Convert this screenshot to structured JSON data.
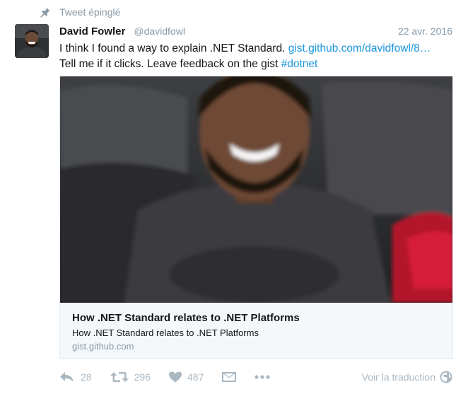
{
  "pinned_label": "Tweet épinglé",
  "tweet": {
    "author_name": "David Fowler",
    "author_handle": "@davidfowl",
    "date": "22 avr. 2016",
    "text_line1_plain": "I think I found a way to explain .NET Standard. ",
    "text_line1_link": "gist.github.com/davidfowl/8…",
    "text_line2_plain": "Tell me if it clicks. Leave feedback on the gist ",
    "hashtag": "#dotnet"
  },
  "card": {
    "title": "How .NET Standard relates to .NET Platforms",
    "description": "How .NET Standard relates to .NET Platforms",
    "domain": "gist.github.com"
  },
  "actions": {
    "reply_count": "28",
    "retweet_count": "296",
    "like_count": "487",
    "translate_label": "Voir la traduction"
  },
  "icons": {
    "pin": "pin-icon",
    "reply": "reply-icon",
    "retweet": "retweet-icon",
    "like": "heart-icon",
    "dm": "envelope-icon",
    "more": "more-icon",
    "globe": "globe-icon"
  },
  "colors": {
    "link": "#1b95e0",
    "muted": "#8899a6",
    "action": "#aab8c2",
    "card_bg": "#f5f8fa"
  }
}
